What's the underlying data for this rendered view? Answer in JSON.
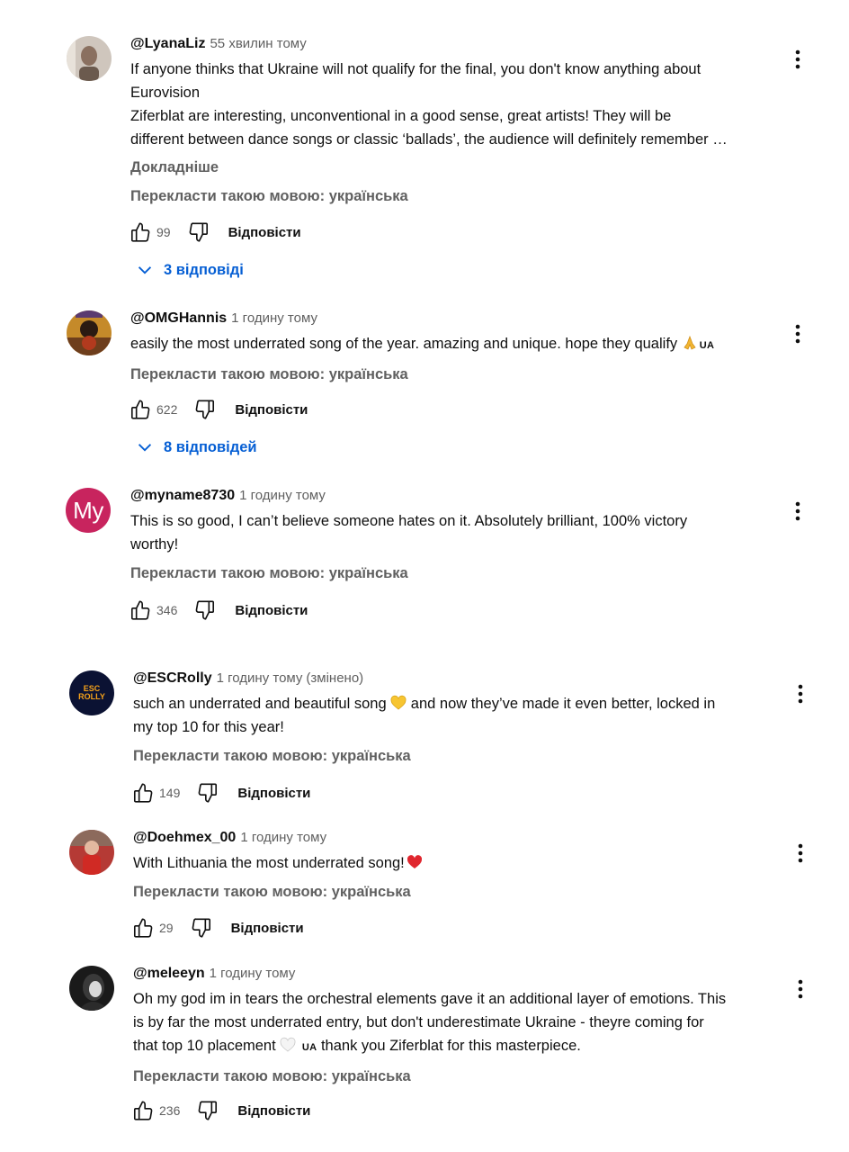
{
  "comments": [
    {
      "handle": "@LyanaLiz",
      "time": "55 хвилин тому",
      "text": "If anyone thinks that Ukraine will not qualify for the final, you don't know anything about\nEurovision\nZiferblat are interesting, unconventional in a good sense, great artists! They will be\ndifferent between dance songs or classic ‘ballads’, the audience will definitely remember …",
      "more": "Докладніше",
      "translate": "Перекласти такою мовою: українська",
      "likes": "99",
      "reply": "Відповісти",
      "replies": "3 відповіді"
    },
    {
      "handle": "@OMGHannis",
      "time": "1 годину тому",
      "text": "easily the most underrated song of the year. amazing and unique. hope they qualify ",
      "flag": "UA",
      "translate": "Перекласти такою мовою: українська",
      "likes": "622",
      "reply": "Відповісти",
      "replies": "8 відповідей"
    },
    {
      "handle": "@myname8730",
      "avatar_text": "My",
      "time": "1 годину тому",
      "text": "This is so good, I can’t believe someone hates on it. Absolutely brilliant, 100% victory\nworthy!",
      "translate": "Перекласти такою мовою: українська",
      "likes": "346",
      "reply": "Відповісти"
    },
    {
      "handle": "@ESCRolly",
      "avatar_text": "ESC\nROLLY",
      "time": "1 годину тому",
      "edited": "(змінено)",
      "text_a": "such an underrated and beautiful song ",
      "text_b": " and now they’ve made it even better, locked in\nmy top 10 for this year!",
      "translate": "Перекласти такою мовою: українська",
      "likes": "149",
      "reply": "Відповісти"
    },
    {
      "handle": "@Doehmex_00",
      "time": "1 годину тому",
      "text": "With Lithuania the most underrated song!",
      "translate": "Перекласти такою мовою: українська",
      "likes": "29",
      "reply": "Відповісти"
    },
    {
      "handle": "@meleeyn",
      "time": "1 годину тому",
      "text_a": "Oh my god im in tears the orchestral elements gave it an additional layer of emotions. This\nis by far the most underrated entry, but don't underestimate Ukraine - theyre coming for\nthat top 10 placement ",
      "flag": "UA",
      "text_b": " thank you Ziferblat for this masterpiece.",
      "translate": "Перекласти такою мовою: українська",
      "likes": "236",
      "reply": "Відповісти"
    }
  ],
  "colors": {
    "link_blue": "#065fd4",
    "secondary_text": "#606060",
    "myname_avatar": "#c8245e",
    "escrolly_avatar": "#0b1233"
  }
}
